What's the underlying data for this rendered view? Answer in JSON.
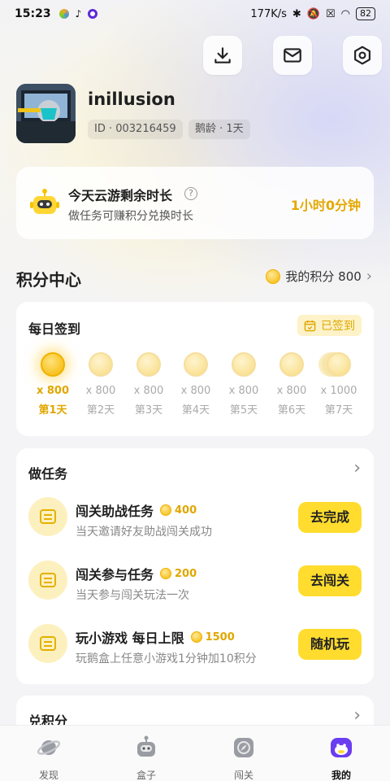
{
  "status_bar": {
    "time": "15:23",
    "net_speed": "177K/s",
    "battery": "82"
  },
  "profile": {
    "username": "inillusion",
    "id": "ID · 003216459",
    "age": "鹅龄 · 1天"
  },
  "time_card": {
    "title": "今天云游剩余时长",
    "subtitle": "做任务可赚积分兑换时长",
    "value": "1小时0分钟"
  },
  "points_center": {
    "title": "积分中心",
    "my_points": "我的积分 800"
  },
  "signin": {
    "title": "每日签到",
    "status": "已签到",
    "days": [
      {
        "points": "x 800",
        "label": "第1天"
      },
      {
        "points": "x 800",
        "label": "第2天"
      },
      {
        "points": "x 800",
        "label": "第3天"
      },
      {
        "points": "x 800",
        "label": "第4天"
      },
      {
        "points": "x 800",
        "label": "第5天"
      },
      {
        "points": "x 800",
        "label": "第6天"
      },
      {
        "points": "x 1000",
        "label": "第7天"
      }
    ]
  },
  "tasks": {
    "title": "做任务",
    "items": [
      {
        "title": "闯关助战任务",
        "points": "400",
        "desc": "当天邀请好友助战闯关成功",
        "button": "去完成"
      },
      {
        "title": "闯关参与任务",
        "points": "200",
        "desc": "当天参与闯关玩法一次",
        "button": "去闯关"
      },
      {
        "title": "玩小游戏 每日上限",
        "points": "1500",
        "desc": "玩鹅盒上任意小游戏1分钟加10积分",
        "button": "随机玩"
      }
    ]
  },
  "exchange": {
    "title": "兑积分"
  },
  "nav": [
    {
      "label": "发现"
    },
    {
      "label": "盒子"
    },
    {
      "label": "闯关"
    },
    {
      "label": "我的"
    }
  ],
  "colors": {
    "accent_yellow": "#ffdc2e",
    "gold_text": "#e0a700"
  }
}
